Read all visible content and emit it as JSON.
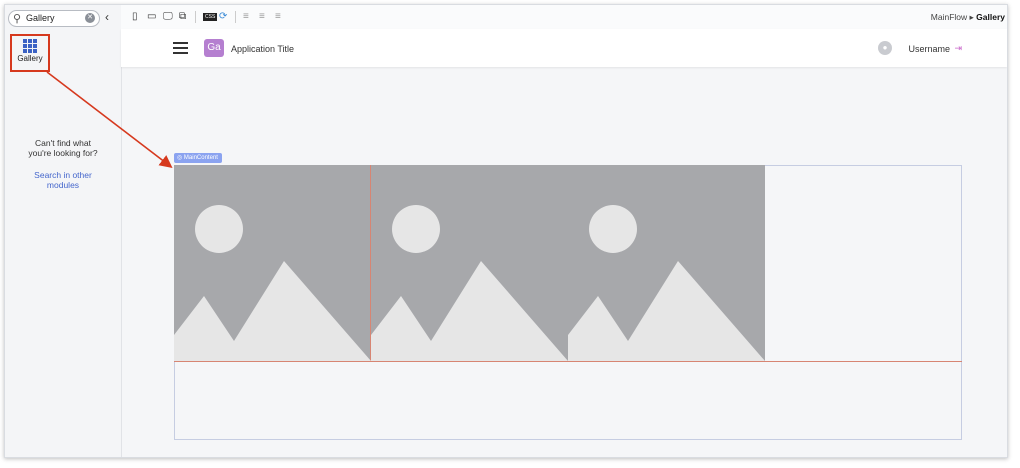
{
  "search": {
    "value": "Gallery"
  },
  "widget": {
    "label": "Gallery"
  },
  "not_found": {
    "line1": "Can't find what",
    "line2": "you're looking for?",
    "link1": "Search in other",
    "link2": "modules"
  },
  "breadcrumb": {
    "parent": "MainFlow",
    "separator": "▸",
    "current": "Gallery"
  },
  "app": {
    "logo": "Ga",
    "title": "Application Title"
  },
  "user": {
    "name": "Username"
  },
  "main_content": {
    "tag": "MainContent"
  },
  "gallery": {
    "items": 3
  },
  "colors": {
    "accent": "#3b62c4",
    "highlight": "#d6391e",
    "logo_bg": "#b57fd0",
    "placeholder": "#a7a8ab"
  },
  "icons": {
    "search": "search-icon",
    "clear": "clear-icon",
    "collapse": "chevron-left-icon",
    "phone": "phone-icon",
    "tablet": "tablet-icon",
    "desktop": "desktop-icon",
    "watch": "watch-icon",
    "css": "css-icon",
    "sync": "sync-icon",
    "align_left": "align-left-icon",
    "align_center": "align-center-icon",
    "align_right": "align-right-icon",
    "menu": "hamburger-icon",
    "avatar": "avatar-icon",
    "logout": "logout-icon"
  }
}
